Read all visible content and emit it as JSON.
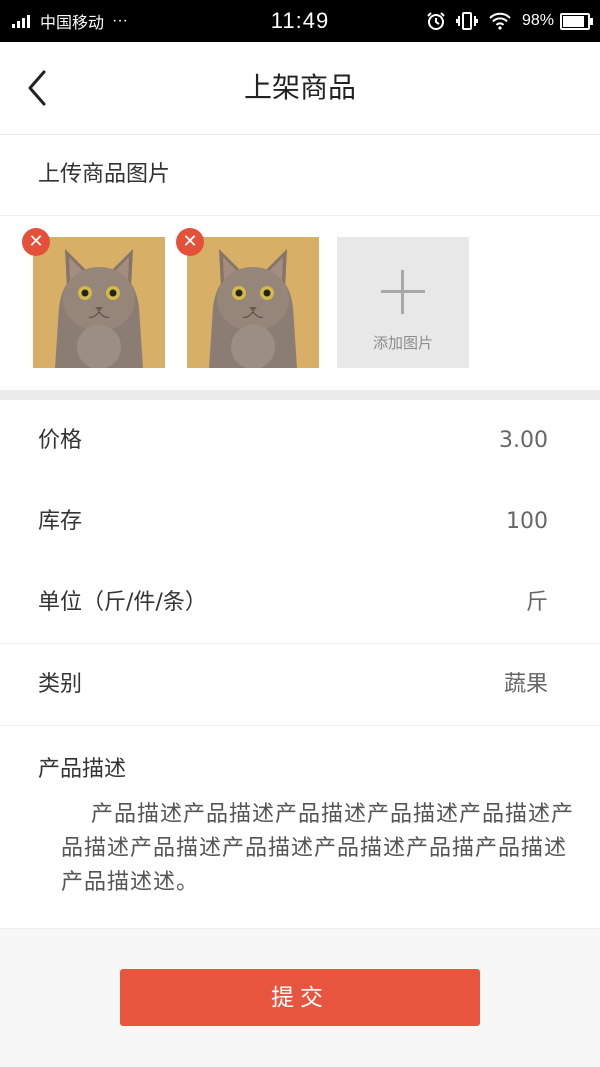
{
  "status_bar": {
    "carrier": "中国移动",
    "more": "···",
    "time": "11:49",
    "battery": "98%"
  },
  "header": {
    "title": "上架商品"
  },
  "upload": {
    "label": "上传商品图片",
    "add_label": "添加图片",
    "images": [
      {
        "icon": "cat-photo"
      },
      {
        "icon": "cat-photo"
      }
    ]
  },
  "form": {
    "price": {
      "label": "价格",
      "value": "3.00"
    },
    "stock": {
      "label": "库存",
      "value": "100"
    },
    "unit": {
      "label": "单位（斤/件/条）",
      "value": "斤"
    },
    "category": {
      "label": "类别",
      "value": "蔬果"
    },
    "description": {
      "label": "产品描述",
      "text": "产品描述产品描述产品描述产品描述产品描述产品描述产品描述产品描述产品描述产品描产品描述产品描述述。"
    }
  },
  "submit_label": "提交",
  "colors": {
    "accent": "#e8553e",
    "delete_badge": "#e5503a",
    "page_bg": "#f7f7f7"
  }
}
